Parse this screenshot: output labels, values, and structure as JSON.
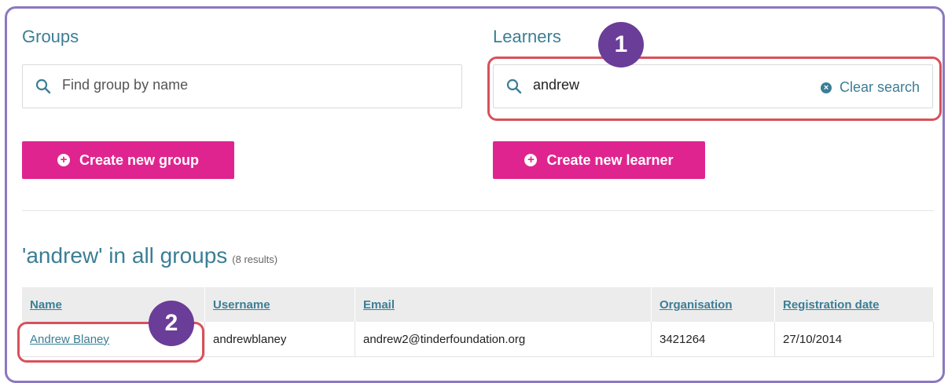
{
  "groups": {
    "heading": "Groups",
    "search_placeholder": "Find group by name",
    "create_button": "Create new group"
  },
  "learners": {
    "heading": "Learners",
    "search_value": "andrew",
    "clear_label": "Clear search",
    "create_button": "Create new learner"
  },
  "results": {
    "title": "'andrew' in all groups",
    "count": "(8 results)",
    "columns": [
      "Name",
      "Username",
      "Email",
      "Organisation",
      "Registration date"
    ],
    "rows": [
      {
        "name": "Andrew Blaney",
        "username": "andrewblaney",
        "email": "andrew2@tinderfoundation.org",
        "organisation": "3421264",
        "registration_date": "27/10/2014"
      }
    ]
  },
  "annotations": {
    "badge_1": "1",
    "badge_2": "2"
  },
  "colors": {
    "accent_teal": "#3b7e95",
    "button_pink": "#e0248f",
    "badge_purple": "#6a3d98",
    "highlight_red": "#d9505a",
    "frame_purple": "#8b78c0"
  }
}
